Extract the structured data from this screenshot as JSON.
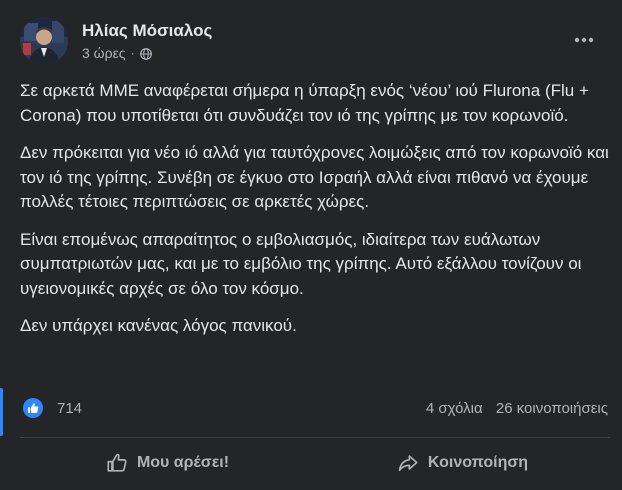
{
  "post": {
    "author": "Ηλίας Μόσιαλος",
    "timestamp": "3 ώρες",
    "separator": "·",
    "paragraphs": [
      "Σε αρκετά ΜΜΕ αναφέρεται σήμερα η ύπαρξη ενός ‘νέου’ ιού Flurona (Flu + Corona) που υποτίθεται ότι συνδυάζει τον ιό της γρίπης με τον κορωνοϊό.",
      "Δεν πρόκειται για νέο ιό αλλά για ταυτόχρονες λοιμώξεις από τον κορωνοϊό και τον ιό της γρίπης. Συνέβη σε έγκυο στο Ισραήλ αλλά είναι πιθανό να έχουμε πολλές τέτοιες περιπτώσεις σε αρκετές χώρες.",
      "Είναι επομένως απαραίτητος ο εμβολιασμός, ιδιαίτερα των ευάλωτων συμπατριωτών μας, και με το εμβόλιο της γρίπης. Αυτό εξάλλου τονίζουν οι υγειονομικές αρχές σε όλο τον κόσμο.",
      "Δεν υπάρχει κανένας λόγος πανικού."
    ],
    "icons": {
      "privacy": "globe-icon",
      "more": "more-horizontal-icon",
      "reaction": "like-icon"
    }
  },
  "stats": {
    "reactions": "714",
    "comments": "4 σχόλια",
    "shares": "26 κοινοποιήσεις"
  },
  "actions": {
    "like_label": "Μου αρέσει!",
    "share_label": "Κοινοποίηση"
  },
  "colors": {
    "background": "#242526",
    "text_primary": "#e4e6eb",
    "text_secondary": "#b0b3b8",
    "accent": "#2d88ff",
    "divider": "#3e4042"
  }
}
